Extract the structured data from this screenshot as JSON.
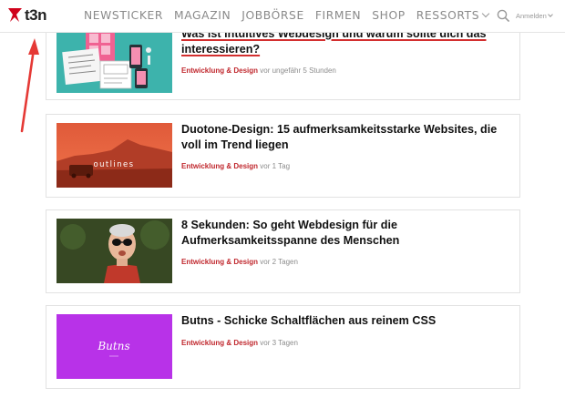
{
  "header": {
    "logo_text": "t3n",
    "nav": [
      "NEWSTICKER",
      "MAGAZIN",
      "JOBBÖRSE",
      "FIRMEN",
      "SHOP",
      "RESSORTS"
    ],
    "login_label": "Anmelden"
  },
  "articles": [
    {
      "title": "Was ist intuitives Webdesign und warum sollte dich das interessieren?",
      "category": "Entwicklung & Design",
      "time": "vor ungefähr 5 Stunden"
    },
    {
      "title": "Duotone-Design: 15 aufmerksamkeitsstarke Websites, die voll im Trend liegen",
      "category": "Entwicklung & Design",
      "time": "vor 1 Tag",
      "thumb_text": "outlines"
    },
    {
      "title": "8 Sekunden: So geht Webdesign für die Aufmerksamkeitsspanne des Menschen",
      "category": "Entwicklung & Design",
      "time": "vor 2 Tagen"
    },
    {
      "title": "Butns - Schicke Schaltflächen aus reinem CSS",
      "category": "Entwicklung & Design",
      "time": "vor 3 Tagen",
      "thumb_text": "Butns"
    }
  ],
  "colors": {
    "brand_red": "#d0021b",
    "category_red": "#c0282e",
    "annotation_arrow": "#e53935"
  }
}
